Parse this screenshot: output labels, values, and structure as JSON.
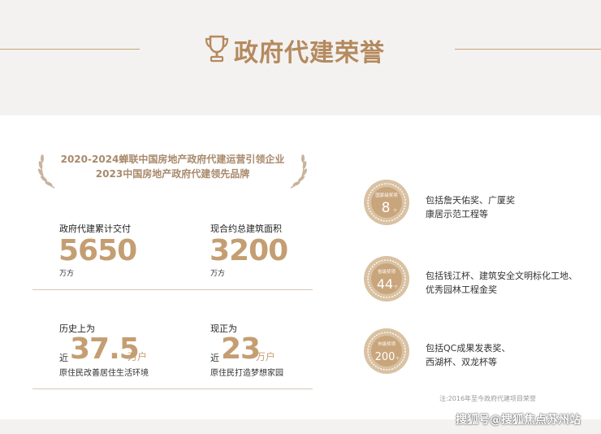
{
  "header": {
    "title": "政府代建荣誉"
  },
  "banner": {
    "line1": "2020-2024蝉联中国房地产政府代建运营引领企业",
    "line2": "2023中国房地产政府代建领先品牌"
  },
  "stats": [
    {
      "label": "政府代建累计交付",
      "value": "5650",
      "unit": "万方"
    },
    {
      "label": "现合约总建筑面积",
      "value": "3200",
      "unit": "万方"
    }
  ],
  "history": [
    {
      "label": "历史上为",
      "prefix": "近",
      "value": "37.5",
      "unit": "万户",
      "desc": "原住民改善居住生活环境"
    },
    {
      "label": "现正为",
      "prefix": "近",
      "value": "23",
      "unit": "万户",
      "desc": "原住民打造梦想家园"
    }
  ],
  "awards": [
    {
      "badge_title": "国家级奖项",
      "count": "8",
      "suffix": "个",
      "line1": "包括詹天佑奖、广厦奖",
      "line2": "康居示范工程等"
    },
    {
      "badge_title": "省级奖项",
      "count": "44",
      "suffix": "个",
      "line1": "包括钱江杯、建筑安全文明标化工地、",
      "line2": "优秀园林工程金奖"
    },
    {
      "badge_title": "市级奖项",
      "count": "200",
      "suffix": "个",
      "line1": "包括QC成果发表奖、",
      "line2": "西湖杯、双龙杯等"
    }
  ],
  "note": "注:2016年至今政府代建项目荣誉",
  "watermark": "搜狐号@搜狐焦点苏州站",
  "colors": {
    "gold": "#c49e72",
    "title_gold": "#b48a5e",
    "medal": "#d2b896"
  }
}
